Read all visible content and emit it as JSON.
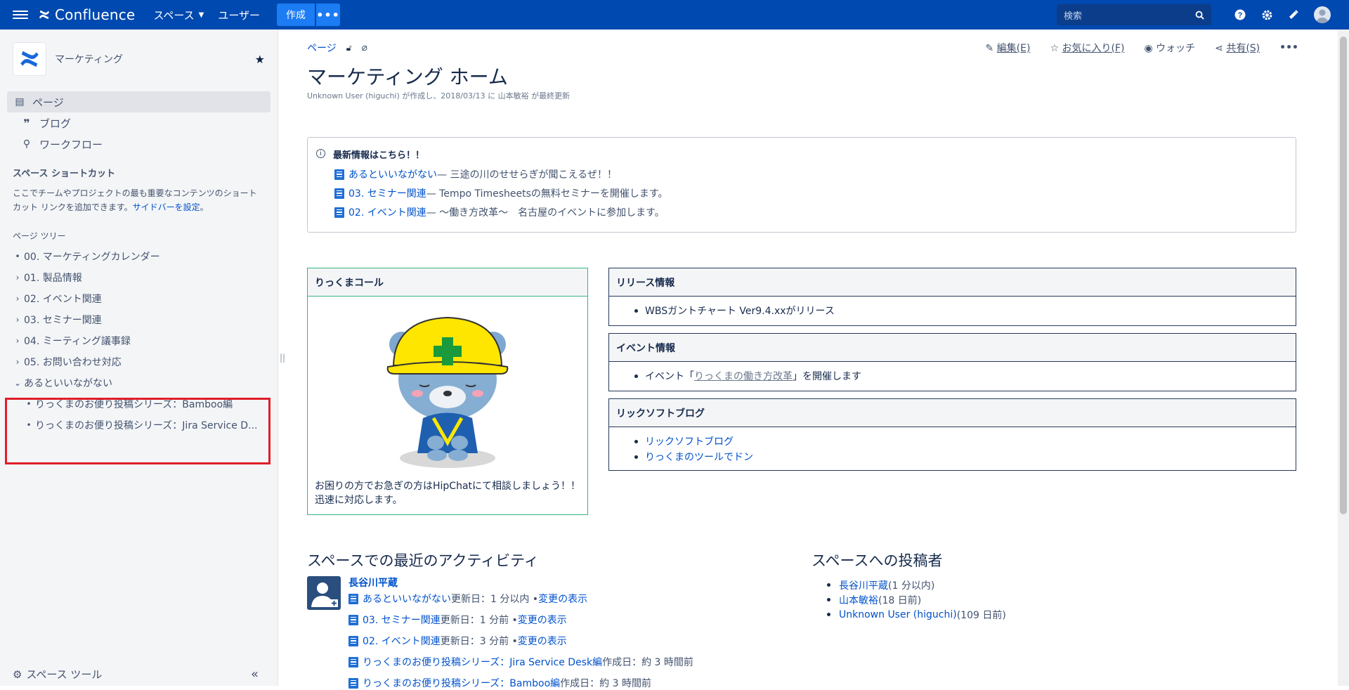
{
  "topnav": {
    "brand": "Confluence",
    "spaces": "スペース",
    "users": "ユーザー",
    "create": "作成",
    "more": "•••",
    "search_placeholder": "検索"
  },
  "sidebar": {
    "space_name": "マーケティング",
    "nav": [
      {
        "label": "ページ",
        "icon": "page-icon"
      },
      {
        "label": "ブログ",
        "icon": "quote-icon"
      },
      {
        "label": "ワークフロー",
        "icon": "workflow-icon"
      }
    ],
    "shortcuts_title": "スペース ショートカット",
    "shortcuts_text": "ここでチームやプロジェクトの最も重要なコンテンツのショートカット リンクを追加できます。",
    "shortcuts_link": "サイドバーを設定",
    "shortcuts_end": "。",
    "tree_title": "ページ ツリー",
    "tree": [
      {
        "label": "00. マーケティングカレンダー",
        "marker": "•"
      },
      {
        "label": "01. 製品情報",
        "marker": "›"
      },
      {
        "label": "02. イベント関連",
        "marker": "›"
      },
      {
        "label": "03. セミナー関連",
        "marker": "›"
      },
      {
        "label": "04. ミーティング議事録",
        "marker": "›"
      },
      {
        "label": "05. お問い合わせ対応",
        "marker": "›"
      },
      {
        "label": "あるといいながない",
        "marker": "⌄"
      },
      {
        "label": "りっくまのお便り投稿シリーズ：Bamboo編",
        "marker": "•"
      },
      {
        "label": "りっくまのお便り投稿シリーズ：Jira Service D...",
        "marker": "•"
      }
    ],
    "space_tools": "スペース ツール",
    "collapse": "«"
  },
  "page": {
    "breadcrumb": "ページ",
    "actions": {
      "edit": "編集(E)",
      "favorite": "お気に入り(F)",
      "watch": "ウォッチ",
      "share": "共有(S)",
      "more": "•••"
    },
    "title": "マーケティング ホーム",
    "byline": "Unknown User (higuchi) が作成し、2018/03/13 に 山本敏裕 が最終更新",
    "info": {
      "title": "最新情報はこちら！！",
      "items": [
        {
          "link": "あるといいながない",
          "text": " — 三途の川のせせらぎが聞こえるぜ！！"
        },
        {
          "link": "03. セミナー関連",
          "text": " — Tempo Timesheetsの無料セミナーを開催します。"
        },
        {
          "link": "02. イベント関連",
          "text": " — ～働き方改革～　名古屋のイベントに参加します。"
        }
      ]
    },
    "bear_panel": {
      "title": "りっくまコール",
      "note": "お困りの方でお急ぎの方はHipChatにて相談しましょう！！迅速に対応します。"
    },
    "release_panel": {
      "title": "リリース情報",
      "items": [
        "WBSガントチャート Ver9.4.xxがリリース"
      ]
    },
    "event_panel": {
      "title": "イベント情報",
      "prefix": "イベント「",
      "link": "りっくまの働き方改革",
      "suffix": "」を開催します"
    },
    "blog_panel": {
      "title": "リックソフトブログ",
      "items": [
        "リックソフトブログ",
        "りっくまのツールでドン"
      ]
    },
    "activity": {
      "title": "スペースでの最近のアクティビティ",
      "user": "長谷川平蔵",
      "rows": [
        {
          "link": "あるといいながない",
          "meta": " 更新日：1 分以内 • ",
          "change": "変更の表示"
        },
        {
          "link": "03. セミナー関連",
          "meta": " 更新日：1 分前 • ",
          "change": "変更の表示"
        },
        {
          "link": "02. イベント関連",
          "meta": " 更新日：3 分前 • ",
          "change": "変更の表示"
        },
        {
          "link": "りっくまのお便り投稿シリーズ：Jira Service Desk編",
          "meta": " 作成日：約 3 時間前",
          "change": ""
        },
        {
          "link": "りっくまのお便り投稿シリーズ：Bamboo編",
          "meta": " 作成日：約 3 時間前",
          "change": ""
        }
      ]
    },
    "contributors": {
      "title": "スペースへの投稿者",
      "items": [
        {
          "name": "長谷川平蔵",
          "meta": " (1 分以内)"
        },
        {
          "name": "山本敏裕",
          "meta": " (18 日前)"
        },
        {
          "name": "Unknown User (higuchi)",
          "meta": " (109 日前)"
        }
      ]
    }
  },
  "colors": {
    "topnav": "#0049b0",
    "accent": "#0052cc",
    "highlight_border": "#e01e29",
    "bear_panel_border": "#36b37e"
  }
}
